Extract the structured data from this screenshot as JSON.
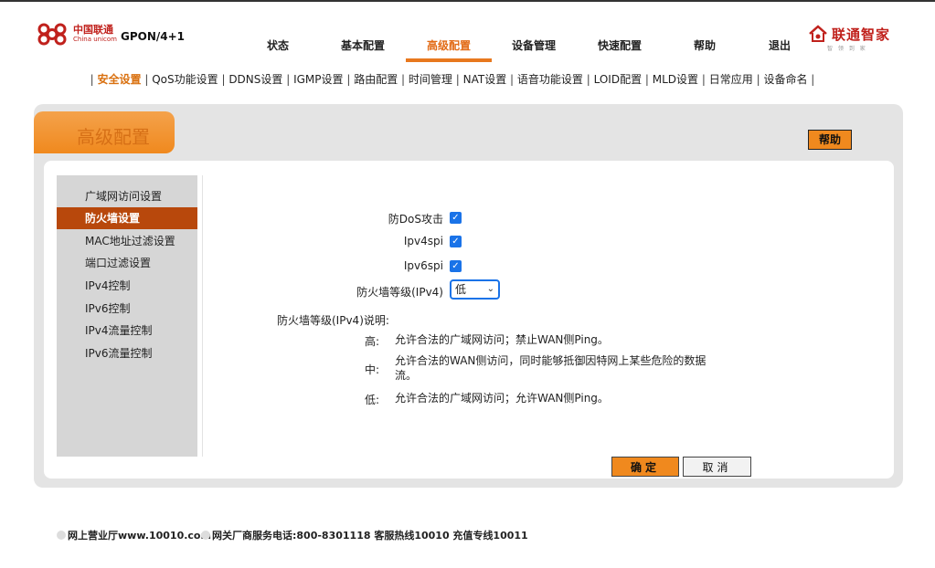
{
  "header": {
    "logo_cn": "中国联通",
    "logo_en": "China unicom",
    "model": "GPON/4+1",
    "brand": "联通智家",
    "brand_sub": "智 领 到 家"
  },
  "nav": {
    "items": [
      {
        "label": "状态"
      },
      {
        "label": "基本配置"
      },
      {
        "label": "高级配置",
        "active": true
      },
      {
        "label": "设备管理"
      },
      {
        "label": "快速配置"
      },
      {
        "label": "帮助"
      },
      {
        "label": "退出"
      }
    ]
  },
  "subnav": {
    "items": [
      "安全设置",
      "QoS功能设置",
      "DDNS设置",
      "IGMP设置",
      "路由配置",
      "时间管理",
      "NAT设置",
      "语音功能设置",
      "LOID配置",
      "MLD设置",
      "日常应用",
      "设备命名"
    ],
    "active_index": 0
  },
  "panel": {
    "title": "高级配置",
    "help_label": "帮助"
  },
  "sidebar": {
    "items": [
      {
        "label": "广域网访问设置"
      },
      {
        "label": "防火墙设置",
        "active": true
      },
      {
        "label": "MAC地址过滤设置"
      },
      {
        "label": "端口过滤设置"
      },
      {
        "label": "IPv4控制"
      },
      {
        "label": "IPv6控制"
      },
      {
        "label": "IPv4流量控制"
      },
      {
        "label": "IPv6流量控制"
      }
    ]
  },
  "form": {
    "dos_label": "防DoS攻击",
    "dos_checked": true,
    "ipv4spi_label": "Ipv4spi",
    "ipv4spi_checked": true,
    "ipv6spi_label": "Ipv6spi",
    "ipv6spi_checked": true,
    "level_label": "防火墙等级(IPv4)",
    "level_value": "低",
    "check_glyph": "✓",
    "chevron": "⌄"
  },
  "description": {
    "heading": "防火墙等级(IPv4)说明:",
    "levels": [
      {
        "name": "高:",
        "text": "允许合法的广域网访问；禁止WAN侧Ping。"
      },
      {
        "name": "中:",
        "text": "允许合法的WAN侧访问，同时能够抵御因特网上某些危险的数据流。"
      },
      {
        "name": "低:",
        "text": "允许合法的广域网访问；允许WAN侧Ping。"
      }
    ]
  },
  "buttons": {
    "ok": "确定",
    "cancel": "取消"
  },
  "footer": {
    "link1": "网上营业厅www.10010.com",
    "link2": "网关厂商服务电话:800-8301118 客服热线10010 充值专线10011"
  },
  "colors": {
    "accent": "#f0891e",
    "active_side": "#b8480c",
    "brand_red": "#c0211c",
    "checkbox": "#1a73e8"
  }
}
